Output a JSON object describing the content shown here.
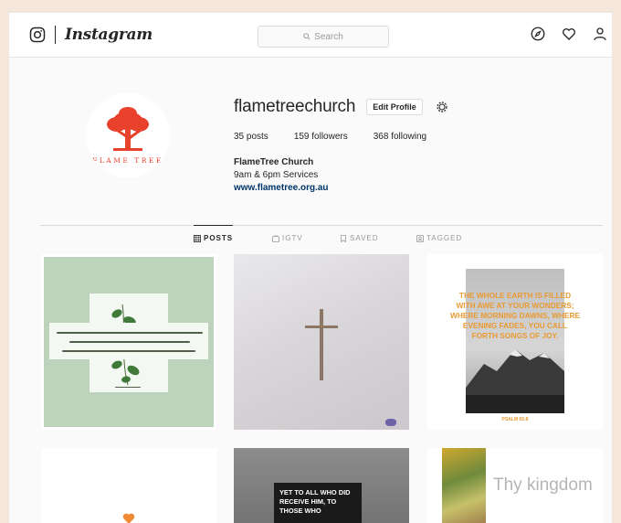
{
  "header": {
    "wordmark": "Instagram",
    "search_placeholder": "Search"
  },
  "profile": {
    "username": "flametreechurch",
    "edit_label": "Edit Profile",
    "avatar_text": "FLAME TREE",
    "stats": {
      "posts": "35 posts",
      "followers": "159 followers",
      "following": "368 following"
    },
    "bio": {
      "name": "FlameTree Church",
      "line": "9am & 6pm Services",
      "link": "www.flametree.org.au"
    }
  },
  "tabs": [
    {
      "label": "POSTS"
    },
    {
      "label": "IGTV"
    },
    {
      "label": "SAVED"
    },
    {
      "label": "TAGGED"
    }
  ],
  "posts": {
    "post3_text": "The whole earth is filled with awe at your wonders; where morning dawns, where evening fades, you call forth songs of joy.",
    "post3_ref": "PSALM 65:8",
    "post5_text": "Yet to all who did receive him, to those who",
    "post6_text": "Thy kingdom"
  },
  "colors": {
    "avatar_red": "#e8412c",
    "accent_orange": "#e99a32",
    "heart_orange": "#f08a34",
    "green_tile": "#bdd3bb"
  }
}
